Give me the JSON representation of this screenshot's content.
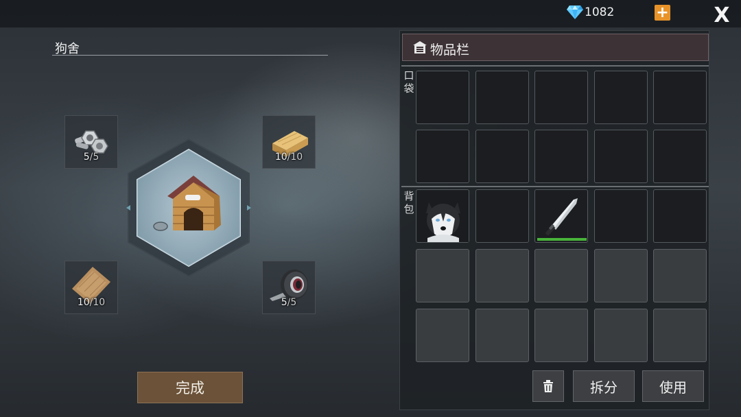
{
  "topbar": {
    "gem_icon": "diamond-icon",
    "gem_count": "1082",
    "add_icon": "plus-icon",
    "close_label": "X"
  },
  "craft": {
    "title": "狗舍",
    "result_icon": "dog-house-icon",
    "materials": [
      {
        "name": "bolts",
        "icon": "bolts-icon",
        "have": "5",
        "need": "5"
      },
      {
        "name": "wood-plank",
        "icon": "wood-plank-icon",
        "have": "10",
        "need": "10"
      },
      {
        "name": "cloth",
        "icon": "cloth-icon",
        "have": "10",
        "need": "10"
      },
      {
        "name": "duct-tape",
        "icon": "tape-roll-icon",
        "have": "5",
        "need": "5"
      }
    ],
    "done_label": "完成"
  },
  "inventory": {
    "title": "物品栏",
    "pocket_label": "口袋",
    "bag_label": "背包",
    "pocket_slots": [
      null,
      null,
      null,
      null,
      null,
      null,
      null,
      null,
      null,
      null
    ],
    "bag_slots": [
      {
        "item": "husky",
        "icon": "husky-dog-icon"
      },
      null,
      {
        "item": "machete",
        "icon": "machete-icon",
        "durability": 1.0
      },
      null,
      null,
      null,
      null,
      null,
      null,
      null,
      null,
      null,
      null,
      null,
      null
    ],
    "buttons": {
      "trash_icon": "trash-icon",
      "split_label": "拆分",
      "use_label": "使用"
    }
  },
  "colors": {
    "accent_orange": "#e8932a",
    "done_button": "#6b5238",
    "durability_green": "#48b43a",
    "header_bg": "#3d3235"
  }
}
